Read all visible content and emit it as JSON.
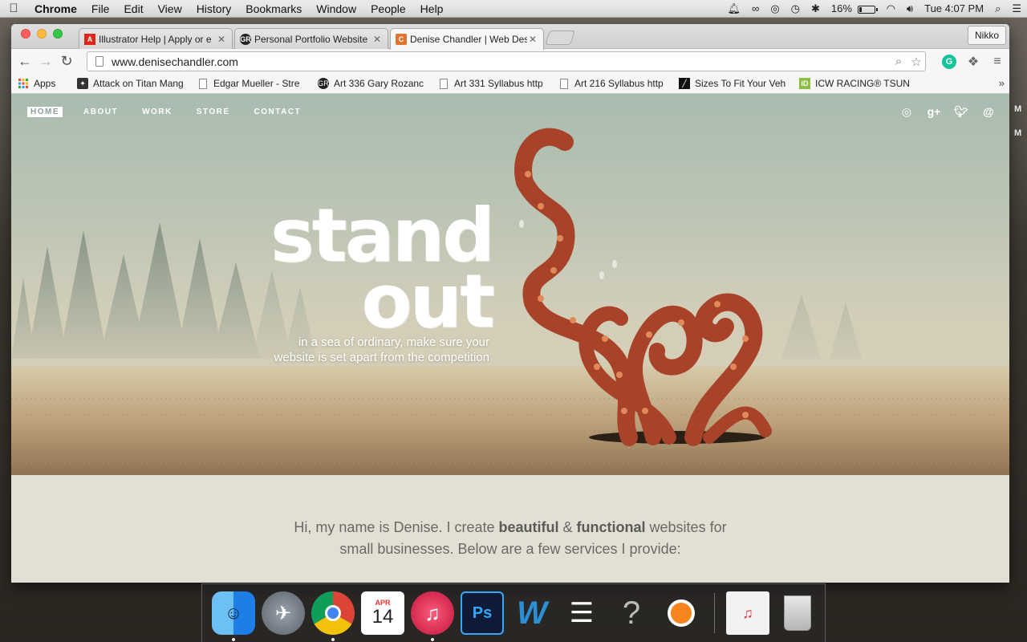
{
  "menubar": {
    "app": "Chrome",
    "menus": [
      "File",
      "Edit",
      "View",
      "History",
      "Bookmarks",
      "Window",
      "People",
      "Help"
    ],
    "battery": "16%",
    "clock": "Tue 4:07 PM"
  },
  "desktop_edge": [
    "M",
    "M"
  ],
  "browser": {
    "profile": "Nikko",
    "tabs": [
      {
        "title": "Illustrator Help | Apply or e",
        "favicon": "adobe-icon",
        "favicon_color": "#e0261b"
      },
      {
        "title": "Personal Portfolio Website",
        "favicon": "gr-icon",
        "favicon_color": "#222222"
      },
      {
        "title": "Denise Chandler | Web Des",
        "favicon": "c-icon",
        "favicon_color": "#e0732e"
      }
    ],
    "active_tab": 2,
    "url": "www.denisechandler.com",
    "bookmarks": [
      {
        "label": "Apps",
        "icon": "apps-grid-icon"
      },
      {
        "label": "Attack on Titan Mang",
        "icon": "manga-icon"
      },
      {
        "label": "Edgar Mueller - Stre",
        "icon": "doc-icon"
      },
      {
        "label": "Art 336 Gary Rozanc",
        "icon": "gr-icon"
      },
      {
        "label": "Art 331 Syllabus http",
        "icon": "doc-icon"
      },
      {
        "label": "Art 216 Syllabus http",
        "icon": "doc-icon"
      },
      {
        "label": "Sizes To Fit Your Veh",
        "icon": "sizes-icon"
      },
      {
        "label": "ICW RACING® TSUN",
        "icon": "id-icon"
      }
    ]
  },
  "site": {
    "nav": [
      "HOME",
      "ABOUT",
      "WORK",
      "STORE",
      "CONTACT"
    ],
    "nav_current": "HOME",
    "social": [
      "dribbble-icon",
      "google-plus-icon",
      "twitter-icon",
      "email-icon"
    ],
    "headline_line1": "stand",
    "headline_line2": "out",
    "tagline_line1": "in a sea of ordinary, make sure your",
    "tagline_line2": "website is set apart from the competition",
    "intro_prefix": "Hi, my name is Denise. I create ",
    "intro_bold1": "beautiful",
    "intro_amp": " & ",
    "intro_bold2": "functional",
    "intro_suffix": " websites for",
    "intro_line2": "small businesses. Below are a few services I provide:",
    "colors": {
      "octopus": "#a8432a",
      "sucker": "#e08a5a",
      "sky": "#a9bcb0",
      "field": "#c9b394"
    }
  },
  "dock": {
    "apps": [
      {
        "name": "finder-icon",
        "running": true
      },
      {
        "name": "launchpad-icon",
        "running": false
      },
      {
        "name": "chrome-icon",
        "running": true
      },
      {
        "name": "calendar-icon",
        "running": false,
        "month": "APR",
        "day": "14"
      },
      {
        "name": "itunes-icon",
        "running": true
      },
      {
        "name": "photoshop-icon",
        "running": false,
        "label": "Ps"
      },
      {
        "name": "wordpress-w-icon",
        "running": false
      },
      {
        "name": "voice-app-icon",
        "running": false
      },
      {
        "name": "unknown-app-icon",
        "running": false
      },
      {
        "name": "avast-icon",
        "running": false
      }
    ],
    "right": [
      "downloads-stack-icon",
      "trash-icon"
    ]
  }
}
